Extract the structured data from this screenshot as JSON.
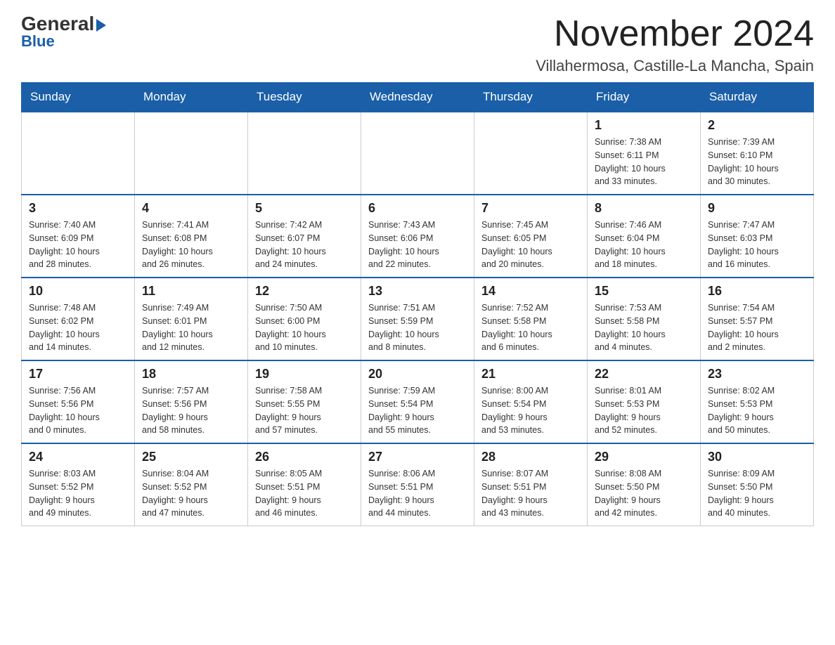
{
  "header": {
    "logo_general": "General",
    "logo_blue": "Blue",
    "month_title": "November 2024",
    "location": "Villahermosa, Castille-La Mancha, Spain"
  },
  "days_of_week": [
    "Sunday",
    "Monday",
    "Tuesday",
    "Wednesday",
    "Thursday",
    "Friday",
    "Saturday"
  ],
  "weeks": [
    [
      {
        "day": "",
        "info": ""
      },
      {
        "day": "",
        "info": ""
      },
      {
        "day": "",
        "info": ""
      },
      {
        "day": "",
        "info": ""
      },
      {
        "day": "",
        "info": ""
      },
      {
        "day": "1",
        "info": "Sunrise: 7:38 AM\nSunset: 6:11 PM\nDaylight: 10 hours\nand 33 minutes."
      },
      {
        "day": "2",
        "info": "Sunrise: 7:39 AM\nSunset: 6:10 PM\nDaylight: 10 hours\nand 30 minutes."
      }
    ],
    [
      {
        "day": "3",
        "info": "Sunrise: 7:40 AM\nSunset: 6:09 PM\nDaylight: 10 hours\nand 28 minutes."
      },
      {
        "day": "4",
        "info": "Sunrise: 7:41 AM\nSunset: 6:08 PM\nDaylight: 10 hours\nand 26 minutes."
      },
      {
        "day": "5",
        "info": "Sunrise: 7:42 AM\nSunset: 6:07 PM\nDaylight: 10 hours\nand 24 minutes."
      },
      {
        "day": "6",
        "info": "Sunrise: 7:43 AM\nSunset: 6:06 PM\nDaylight: 10 hours\nand 22 minutes."
      },
      {
        "day": "7",
        "info": "Sunrise: 7:45 AM\nSunset: 6:05 PM\nDaylight: 10 hours\nand 20 minutes."
      },
      {
        "day": "8",
        "info": "Sunrise: 7:46 AM\nSunset: 6:04 PM\nDaylight: 10 hours\nand 18 minutes."
      },
      {
        "day": "9",
        "info": "Sunrise: 7:47 AM\nSunset: 6:03 PM\nDaylight: 10 hours\nand 16 minutes."
      }
    ],
    [
      {
        "day": "10",
        "info": "Sunrise: 7:48 AM\nSunset: 6:02 PM\nDaylight: 10 hours\nand 14 minutes."
      },
      {
        "day": "11",
        "info": "Sunrise: 7:49 AM\nSunset: 6:01 PM\nDaylight: 10 hours\nand 12 minutes."
      },
      {
        "day": "12",
        "info": "Sunrise: 7:50 AM\nSunset: 6:00 PM\nDaylight: 10 hours\nand 10 minutes."
      },
      {
        "day": "13",
        "info": "Sunrise: 7:51 AM\nSunset: 5:59 PM\nDaylight: 10 hours\nand 8 minutes."
      },
      {
        "day": "14",
        "info": "Sunrise: 7:52 AM\nSunset: 5:58 PM\nDaylight: 10 hours\nand 6 minutes."
      },
      {
        "day": "15",
        "info": "Sunrise: 7:53 AM\nSunset: 5:58 PM\nDaylight: 10 hours\nand 4 minutes."
      },
      {
        "day": "16",
        "info": "Sunrise: 7:54 AM\nSunset: 5:57 PM\nDaylight: 10 hours\nand 2 minutes."
      }
    ],
    [
      {
        "day": "17",
        "info": "Sunrise: 7:56 AM\nSunset: 5:56 PM\nDaylight: 10 hours\nand 0 minutes."
      },
      {
        "day": "18",
        "info": "Sunrise: 7:57 AM\nSunset: 5:56 PM\nDaylight: 9 hours\nand 58 minutes."
      },
      {
        "day": "19",
        "info": "Sunrise: 7:58 AM\nSunset: 5:55 PM\nDaylight: 9 hours\nand 57 minutes."
      },
      {
        "day": "20",
        "info": "Sunrise: 7:59 AM\nSunset: 5:54 PM\nDaylight: 9 hours\nand 55 minutes."
      },
      {
        "day": "21",
        "info": "Sunrise: 8:00 AM\nSunset: 5:54 PM\nDaylight: 9 hours\nand 53 minutes."
      },
      {
        "day": "22",
        "info": "Sunrise: 8:01 AM\nSunset: 5:53 PM\nDaylight: 9 hours\nand 52 minutes."
      },
      {
        "day": "23",
        "info": "Sunrise: 8:02 AM\nSunset: 5:53 PM\nDaylight: 9 hours\nand 50 minutes."
      }
    ],
    [
      {
        "day": "24",
        "info": "Sunrise: 8:03 AM\nSunset: 5:52 PM\nDaylight: 9 hours\nand 49 minutes."
      },
      {
        "day": "25",
        "info": "Sunrise: 8:04 AM\nSunset: 5:52 PM\nDaylight: 9 hours\nand 47 minutes."
      },
      {
        "day": "26",
        "info": "Sunrise: 8:05 AM\nSunset: 5:51 PM\nDaylight: 9 hours\nand 46 minutes."
      },
      {
        "day": "27",
        "info": "Sunrise: 8:06 AM\nSunset: 5:51 PM\nDaylight: 9 hours\nand 44 minutes."
      },
      {
        "day": "28",
        "info": "Sunrise: 8:07 AM\nSunset: 5:51 PM\nDaylight: 9 hours\nand 43 minutes."
      },
      {
        "day": "29",
        "info": "Sunrise: 8:08 AM\nSunset: 5:50 PM\nDaylight: 9 hours\nand 42 minutes."
      },
      {
        "day": "30",
        "info": "Sunrise: 8:09 AM\nSunset: 5:50 PM\nDaylight: 9 hours\nand 40 minutes."
      }
    ]
  ]
}
